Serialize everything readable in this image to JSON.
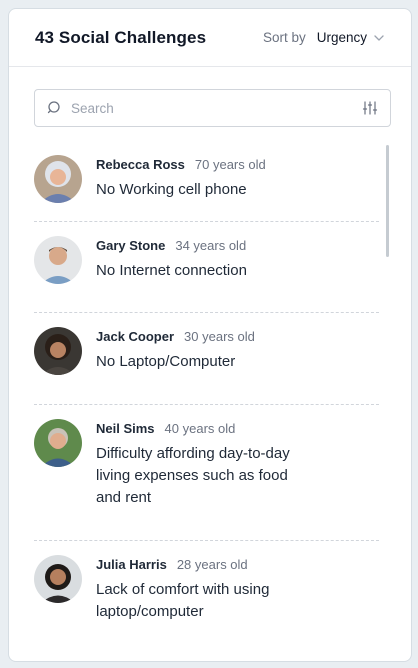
{
  "header": {
    "title": "43 Social Challenges",
    "sort_by_label": "Sort by",
    "sort_value": "Urgency"
  },
  "search": {
    "placeholder": "Search"
  },
  "people": [
    {
      "name": "Rebecca Ross",
      "age": "70 years old",
      "challenge": "No Working cell phone"
    },
    {
      "name": "Gary Stone",
      "age": "34 years old",
      "challenge": "No Internet connection"
    },
    {
      "name": "Jack Cooper",
      "age": "30 years old",
      "challenge": "No Laptop/Computer"
    },
    {
      "name": "Neil Sims",
      "age": "40 years old",
      "challenge": "Difficulty affording day-to-day living expenses such as food and rent"
    },
    {
      "name": "Julia Harris",
      "age": "28 years old",
      "challenge": "Lack of comfort with using laptop/computer"
    }
  ],
  "icons": {
    "search": "search-icon",
    "filter": "sliders-icon",
    "sort_chevron": "chevron-down-icon"
  },
  "colors": {
    "background": "#e9eef2",
    "card": "#ffffff",
    "text": "#1f2937",
    "muted": "#6b7280"
  }
}
